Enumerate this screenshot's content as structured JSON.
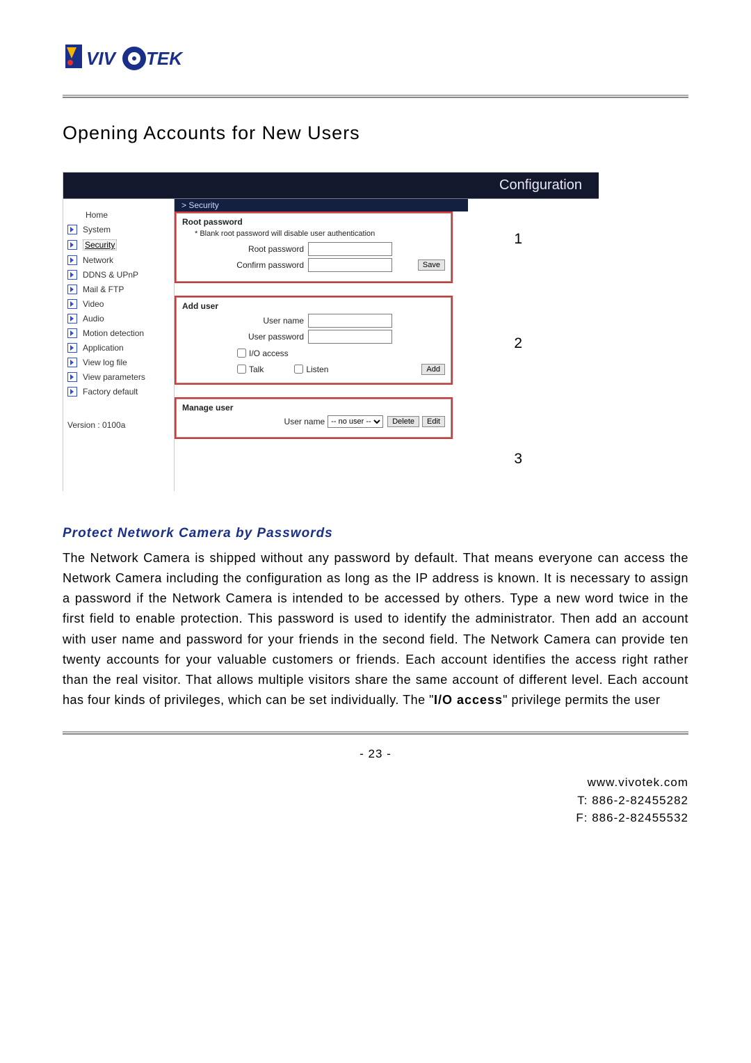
{
  "heading": "Opening Accounts for New Users",
  "screenshot": {
    "config_title": "Configuration",
    "breadcrumb": "> Security",
    "sidebar": {
      "home": "Home",
      "items": [
        "System",
        "Security",
        "Network",
        "DDNS & UPnP",
        "Mail & FTP",
        "Video",
        "Audio",
        "Motion detection",
        "Application",
        "View log file",
        "View parameters",
        "Factory default"
      ],
      "version": "Version : 0100a"
    },
    "panel_root": {
      "legend": "Root password",
      "note": "* Blank root password will disable user authentication",
      "root_pw_label": "Root password",
      "confirm_pw_label": "Confirm password",
      "save_btn": "Save"
    },
    "panel_add": {
      "legend": "Add user",
      "username_label": "User name",
      "userpw_label": "User password",
      "io_label": "I/O access",
      "talk_label": "Talk",
      "listen_label": "Listen",
      "add_btn": "Add"
    },
    "panel_manage": {
      "legend": "Manage user",
      "username_label": "User name",
      "no_user_option": "-- no user --",
      "delete_btn": "Delete",
      "edit_btn": "Edit"
    },
    "callouts": {
      "one": "1",
      "two": "2",
      "three": "3"
    }
  },
  "subheading": "Protect Network Camera by Passwords",
  "body": {
    "p1_a": "The Network Camera is shipped without any password by default. That means everyone can access the Network Camera including the configuration as long as the IP address is known. It is necessary to assign a password if the Network Camera is intended to be accessed by others. Type a new word twice in the first field to enable protection. This password is used to identify the administrator. Then add an account with user name and password for your friends in the second field. The Network Camera can provide ten twenty accounts for your valuable customers or friends. Each account identifies the access right rather than the real visitor. That allows multiple visitors share the same account of different level. Each account has four kinds of privileges, which can be set individually. The \"",
    "bold": "I/O access",
    "p1_b": "\" privilege permits the user"
  },
  "page_number": "- 23 -",
  "footer": {
    "site": "www.vivotek.com",
    "tel": "T: 886-2-82455282",
    "fax": "F: 886-2-82455532"
  }
}
